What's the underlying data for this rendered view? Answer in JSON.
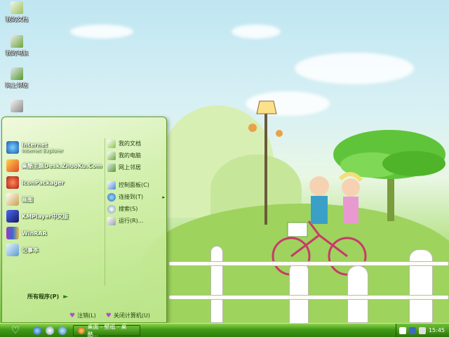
{
  "desktop": {
    "icons": [
      {
        "label": "我的文档",
        "icon": "my-documents-icon"
      },
      {
        "label": "我的电脑",
        "icon": "my-computer-icon"
      },
      {
        "label": "网上邻居",
        "icon": "network-places-icon"
      },
      {
        "label": "",
        "icon": "recycle-bin-icon"
      }
    ]
  },
  "start_menu": {
    "left_items": [
      {
        "label": "Internet",
        "sub": "Internet Explorer",
        "icon": "internet-explorer-icon"
      },
      {
        "label": "桌酷主题Desk.ZhuoKu.Com",
        "icon": "zhuoku-theme-icon"
      },
      {
        "label": "IconPackager",
        "icon": "iconpackager-icon"
      },
      {
        "label": "画图",
        "icon": "paint-icon"
      },
      {
        "label": "KMPlayer中文版",
        "icon": "kmplayer-icon"
      },
      {
        "label": "WinRAR",
        "icon": "winrar-icon"
      },
      {
        "label": "记事本",
        "icon": "notepad-icon"
      }
    ],
    "all_programs": "所有程序(P)",
    "right_items": [
      {
        "label": "我的文档",
        "icon": "my-documents-icon"
      },
      {
        "label": "我的电脑",
        "icon": "my-computer-icon"
      },
      {
        "label": "网上邻居",
        "icon": "network-places-icon"
      },
      {
        "label": "控制面板(C)",
        "icon": "control-panel-icon"
      },
      {
        "label": "连接到(T)",
        "icon": "connect-to-icon"
      },
      {
        "label": "搜索(S)",
        "icon": "search-icon"
      },
      {
        "label": "运行(R)...",
        "icon": "run-icon"
      }
    ],
    "logoff": "注销(L)",
    "shutdown": "关闭计算机(U)"
  },
  "taskbar": {
    "task_label": "桌面 - 壁纸 - 桌酷...",
    "clock": "15:45"
  },
  "colors": {
    "taskbar": "#2e7d0c",
    "menu_border": "#5f9a25"
  }
}
